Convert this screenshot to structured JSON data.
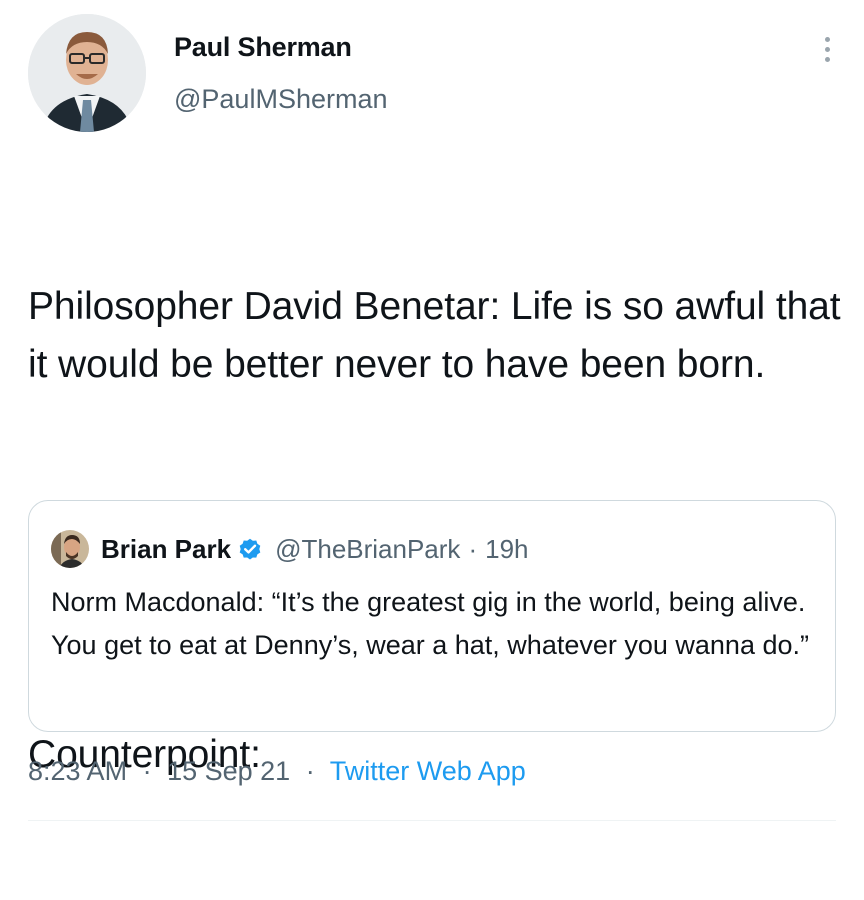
{
  "author": {
    "name": "Paul Sherman",
    "handle": "@PaulMSherman",
    "avatar_icon": "avatar-photo-man-with-glasses"
  },
  "tweet": {
    "paragraphs": [
      "Philosopher David Benetar: Life is so awful that it would be better never to have been born.",
      "Counterpoint:"
    ]
  },
  "quoted_tweet": {
    "name": "Brian Park",
    "verified_icon": "verified-badge-icon",
    "handle": "@TheBrianPark",
    "separator": "·",
    "time": "19h",
    "text": "Norm Macdonald: “It’s the greatest gig in the world, being alive. You get to eat at Denny’s, wear a hat, whatever you wanna do.”"
  },
  "meta": {
    "time": "8:23 AM",
    "separator": "·",
    "date": "15 Sep 21",
    "source": "Twitter Web App"
  },
  "colors": {
    "text": "#0f1419",
    "muted": "#536471",
    "link": "#1d9bf0",
    "border": "#cfd9de"
  }
}
